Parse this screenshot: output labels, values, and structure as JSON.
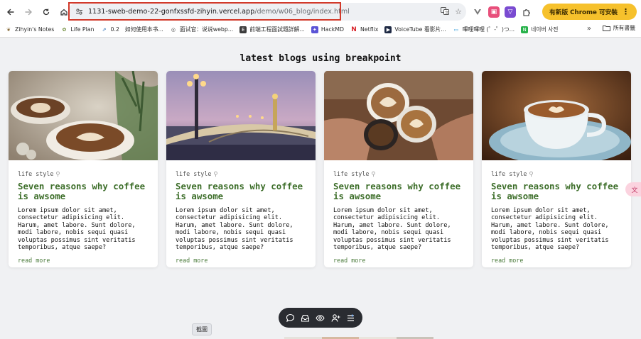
{
  "browser": {
    "url_domain": "1131-sweb-demo-22-gonfxssfd-zihyin.vercel.app",
    "url_path": "/demo/w06_blog/index.html",
    "update_button_label": "有新版 Chrome 可安裝"
  },
  "bookmarks": [
    {
      "label": "Zihyin's Notes",
      "icon": "leaf-icon",
      "color": "#8a6d3b"
    },
    {
      "label": "Life Plan",
      "icon": "leaf-icon",
      "color": "#6f8b3a"
    },
    {
      "label": "0.2　如何使用本书...",
      "icon": "chart-icon",
      "color": "#2f6fb3"
    },
    {
      "label": "面试官：说说webp...",
      "icon": "globe-icon",
      "color": "#444444"
    },
    {
      "label": "前端工程面試題詳解...",
      "icon": "doc-icon",
      "color": "#3b3b3b"
    },
    {
      "label": "HackMD",
      "icon": "hackmd-icon",
      "color": "#5b54d6"
    },
    {
      "label": "Netflix",
      "icon": "netflix-icon",
      "color": "#d81f26"
    },
    {
      "label": "VoiceTube 看影片...",
      "icon": "play-icon",
      "color": "#1f2a44"
    },
    {
      "label": "嗶哩嗶哩 (゜-゜)つ...",
      "icon": "tv-icon",
      "color": "#3aa0dc"
    },
    {
      "label": "네이버 사전",
      "icon": "naver-icon",
      "color": "#27b24a"
    }
  ],
  "bookmarks_all_label": "所有書籤",
  "page": {
    "heading": "latest blogs using breakpoint"
  },
  "cards": [
    {
      "category": "life style",
      "title": "Seven reasons why coffee is awsome",
      "description": "Lorem ipsum dolor sit amet, consectetur adipisicing elit. Harum, amet labore. Sunt dolore, modi labore, nobis sequi quasi voluptas possimus sint veritatis temporibus, atque saepe?",
      "link": "read more",
      "image": "latte-coffee-photo"
    },
    {
      "category": "life style",
      "title": "Seven reasons why coffee is awsome",
      "description": "Lorem ipsum dolor sit amet, consectetur adipisicing elit. Harum, amet labore. Sunt dolore, modi labore, nobis sequi quasi voluptas possimus sint veritatis temporibus, atque saepe?",
      "link": "read more",
      "image": "paris-bridge-photo"
    },
    {
      "category": "life style",
      "title": "Seven reasons why coffee is awsome",
      "description": "Lorem ipsum dolor sit amet, consectetur adipisicing elit. Harum, amet labore. Sunt dolore, modi labore, nobis sequi quasi voluptas possimus sint veritatis temporibus, atque saepe?",
      "link": "read more",
      "image": "coffee-cheers-photo"
    },
    {
      "category": "life style",
      "title": "Seven reasons why coffee is awsome",
      "description": "Lorem ipsum dolor sit amet, consectetur adipisicing elit. Harum, amet labore. Sunt dolore, modi labore, nobis sequi quasi voluptas possimus sint veritatis temporibus, atque saepe?",
      "link": "read more",
      "image": "blue-cup-coffee-photo"
    }
  ],
  "screenshot_tool": {
    "tooltip": "截圖"
  },
  "colors": {
    "title_green": "#3d6e2a",
    "update_yellow": "#f6c12c",
    "highlight_red": "#d23a2b"
  }
}
